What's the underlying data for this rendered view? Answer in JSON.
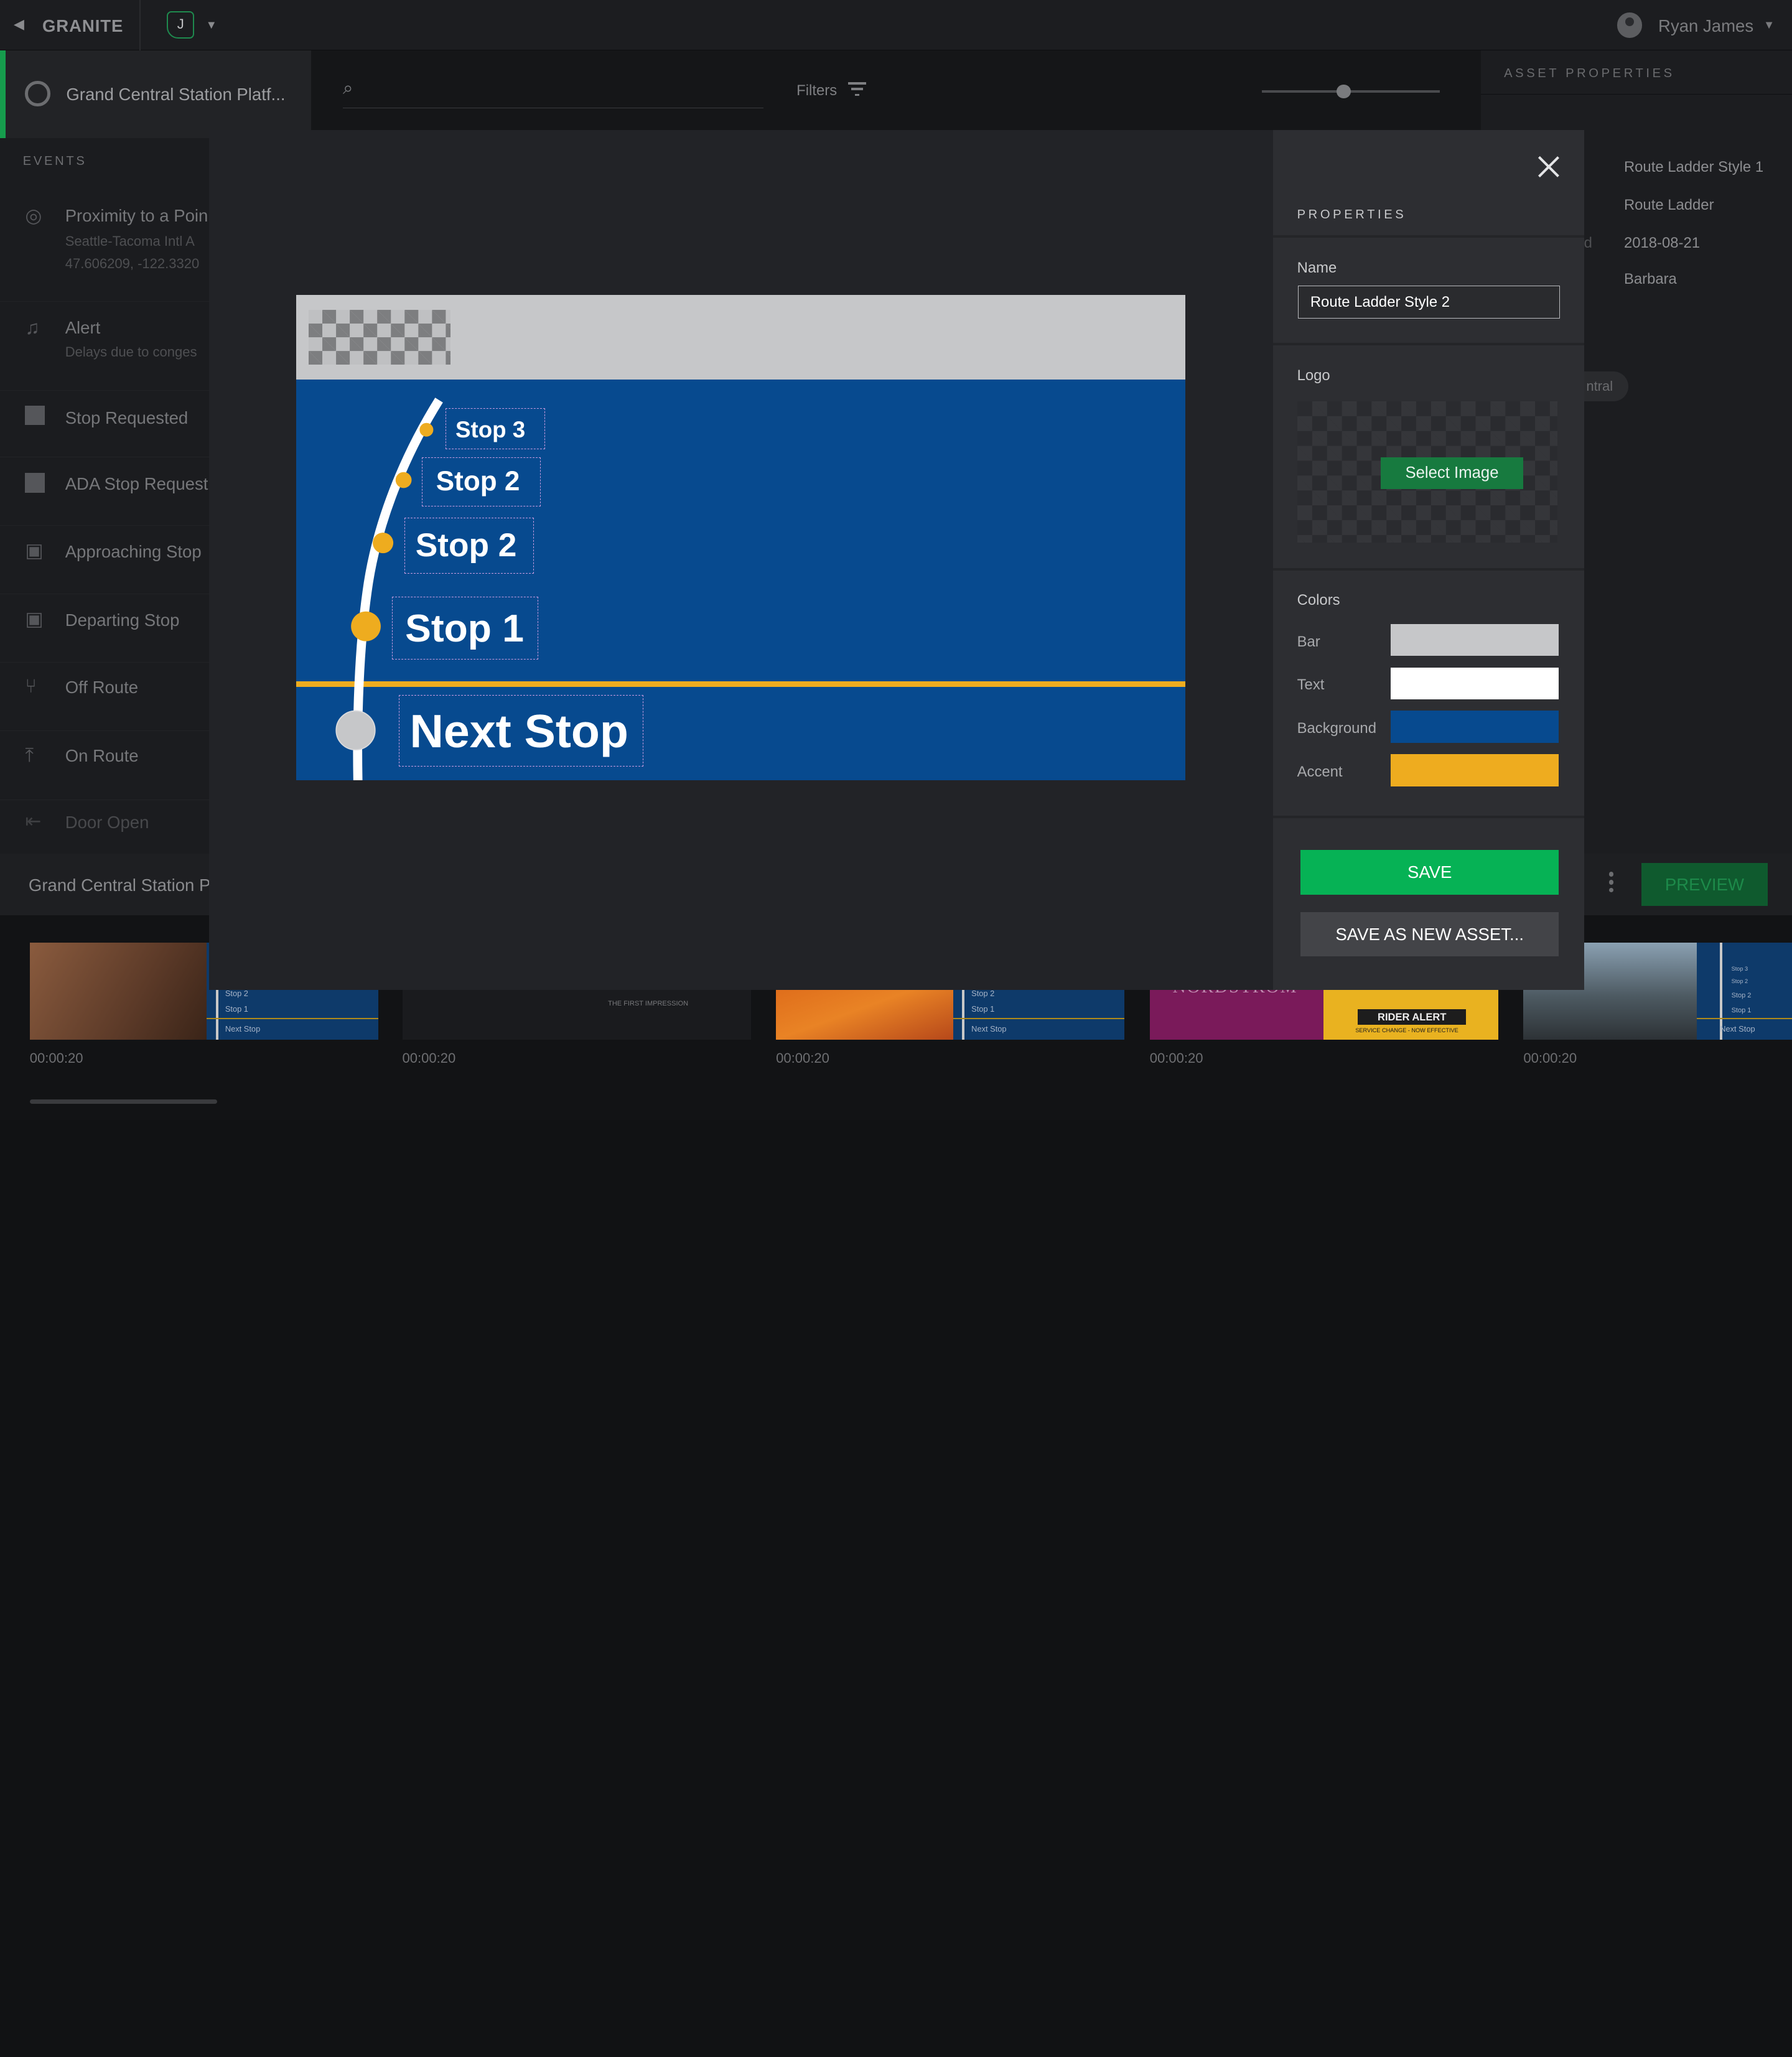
{
  "topbar": {
    "brand": "GRANITE",
    "workspace_initial": "J",
    "user_name": "Ryan James"
  },
  "left_panel": {
    "title": "Grand Central Station Platf...",
    "events_heading": "EVENTS",
    "events": [
      {
        "label": "Proximity to a Poin",
        "sub1": "Seattle-Tacoma Intl A",
        "sub2": "47.606209, -122.3320",
        "icon": "target-icon"
      },
      {
        "label": "Alert",
        "sub1": "Delays due to conges",
        "icon": "bell-icon"
      },
      {
        "label": "Stop Requested",
        "icon": "square-icon"
      },
      {
        "label": "ADA Stop Request",
        "icon": "square-icon"
      },
      {
        "label": "Approaching Stop",
        "icon": "bus-icon"
      },
      {
        "label": "Departing Stop",
        "icon": "bus-icon"
      },
      {
        "label": "Off Route",
        "icon": "fork-icon"
      },
      {
        "label": "On Route",
        "icon": "merge-icon"
      },
      {
        "label": "Door Open",
        "icon": "door-icon"
      }
    ]
  },
  "toolbar": {
    "filters_label": "Filters",
    "zoom_slider": 0.46
  },
  "asset_properties": {
    "heading": "ASSET PROPERTIES",
    "values": [
      "Route Ladder Style 1",
      "Route Ladder",
      "2018-08-21",
      "Barbara"
    ],
    "partial_label": "d",
    "chip": "ntral"
  },
  "bottom": {
    "title": "Grand Central Station P",
    "preview_label": "PREVIEW",
    "times": [
      "00:00:20",
      "00:00:20",
      "00:00:20",
      "00:00:20",
      "00:00:20"
    ],
    "thumb_texts": {
      "stop2": "Stop 2",
      "stop1": "Stop 1",
      "next": "Next Stop",
      "stop3": "Stop 3",
      "impression": "THE FIRST IMPRESSION",
      "nordstrom": "NORDSTROM",
      "rider_alert": "RIDER ALERT",
      "service": "SERVICE CHANGE - NOW EFFECTIVE"
    }
  },
  "modal": {
    "properties_heading": "PROPERTIES",
    "name_label": "Name",
    "name_value": "Route Ladder Style 2",
    "logo_label": "Logo",
    "select_image": "Select Image",
    "colors_label": "Colors",
    "colors": [
      {
        "label": "Bar",
        "hex": "#c6c7c9"
      },
      {
        "label": "Text",
        "hex": "#ffffff"
      },
      {
        "label": "Background",
        "hex": "#074a8f"
      },
      {
        "label": "Accent",
        "hex": "#eeac1f"
      }
    ],
    "save_label": "SAVE",
    "save_as_label": "SAVE AS NEW ASSET...",
    "preview": {
      "stops": [
        "Stop 3",
        "Stop 2",
        "Stop 2",
        "Stop 1"
      ],
      "next_stop": "Next Stop"
    }
  }
}
